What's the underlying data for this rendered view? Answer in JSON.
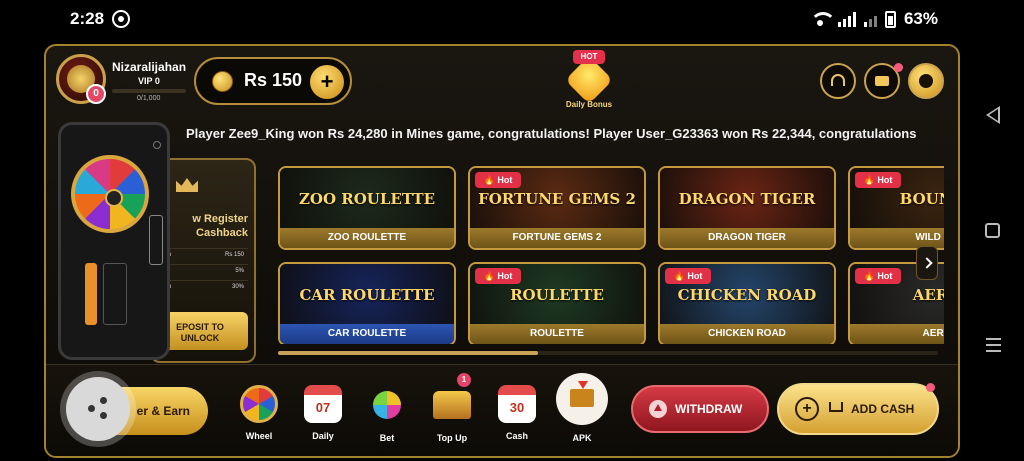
{
  "status_bar": {
    "time": "2:28",
    "battery": "63%"
  },
  "profile": {
    "name": "Nizaralijahan",
    "vip": "VIP 0",
    "progress": "0/1,000",
    "badge": "0"
  },
  "wallet": {
    "balance": "Rs 150",
    "add_symbol": "+"
  },
  "daily_bonus": {
    "badge": "HOT",
    "label": "Daily Bonus"
  },
  "marquee": "Player Zee9_King won Rs 24,280 in Mines game, congratulations! Player User_G23363 won Rs 22,344, congratulations",
  "promo_panel": {
    "title_line1": "w Register",
    "title_line2": "Cashback",
    "rows": [
      {
        "key": "ration",
        "value": "Rs 150"
      },
      {
        "key": "us",
        "value": "5%"
      },
      {
        "key": "ission",
        "value": "30%"
      }
    ],
    "button_line1": "EPOSIT TO",
    "button_line2": "UNLOCK"
  },
  "games": [
    {
      "label": "ZOO ROULETTE",
      "logo": "ZOO ROULETTE",
      "hot": "",
      "color": "#1d2a1c"
    },
    {
      "label": "FORTUNE GEMS 2",
      "logo": "FORTUNE GEMS 2",
      "hot": "Hot",
      "color": "#5b2a12"
    },
    {
      "label": "DRAGON TIGER",
      "logo": "DRAGON TIGER",
      "hot": "",
      "color": "#6a2414"
    },
    {
      "label": "WILD BO",
      "logo": "BOUNTY",
      "hot": "Hot",
      "color": "#3b2410"
    },
    {
      "label": "CAR ROULETTE",
      "logo": "CAR ROULETTE",
      "hot": "",
      "color": "#16245a"
    },
    {
      "label": "ROULETTE",
      "logo": "ROULETTE",
      "hot": "Hot",
      "color": "#1e3a23"
    },
    {
      "label": "CHICKEN ROAD",
      "logo": "CHICKEN ROAD",
      "hot": "Hot",
      "color": "#24456b"
    },
    {
      "label": "AERO",
      "logo": "AERO",
      "hot": "Hot",
      "color": "#2a2a2a"
    }
  ],
  "bottom": {
    "refer": "er & Earn",
    "wheel": "Wheel",
    "daily": "Daily",
    "daily_num": "07",
    "bet": "Bet",
    "topup": "Top Up",
    "topup_badge": "1",
    "cash": "Cash",
    "cash_num": "30",
    "apk": "APK",
    "withdraw": "WITHDRAW",
    "add_cash": "ADD CASH"
  },
  "colors": {
    "gold": "#c9a14b",
    "hot": "#e23047",
    "withdraw": "#c0303a"
  }
}
